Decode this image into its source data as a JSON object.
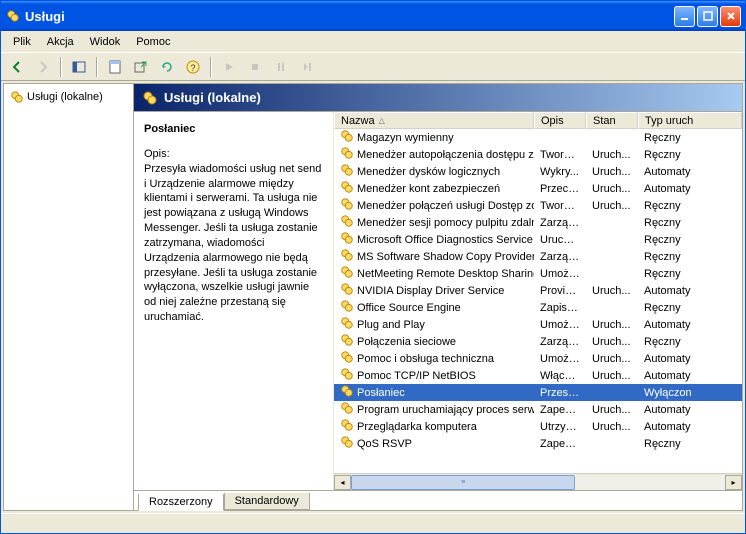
{
  "title": "Usługi",
  "menu": {
    "file": "Plik",
    "action": "Akcja",
    "view": "Widok",
    "help": "Pomoc"
  },
  "tree": {
    "root": "Usługi (lokalne)"
  },
  "header": "Usługi (lokalne)",
  "detail": {
    "name": "Posłaniec",
    "description_label": "Opis:",
    "description": "Przesyła wiadomości usług net send i Urządzenie alarmowe między klientami i serwerami. Ta usługa nie jest powiązana z usługą Windows Messenger. Jeśli ta usługa zostanie zatrzymana, wiadomości Urządzenia alarmowego nie będą przesyłane. Jeśli ta usługa zostanie wyłączona, wszelkie usługi jawnie od niej zależne przestaną się uruchamiać."
  },
  "columns": {
    "name": "Nazwa",
    "desc": "Opis",
    "stat": "Stan",
    "type": "Typ uruch"
  },
  "services": [
    {
      "name": "Magazyn wymienny",
      "desc": "",
      "stat": "",
      "type": "Ręczny",
      "selected": false
    },
    {
      "name": "Menedżer autopołączenia dostępu zd...",
      "desc": "Tworzy...",
      "stat": "Uruch...",
      "type": "Ręczny",
      "selected": false
    },
    {
      "name": "Menedżer dysków logicznych",
      "desc": "Wykry...",
      "stat": "Uruch...",
      "type": "Automaty",
      "selected": false
    },
    {
      "name": "Menedżer kont zabezpieczeń",
      "desc": "Przech...",
      "stat": "Uruch...",
      "type": "Automaty",
      "selected": false
    },
    {
      "name": "Menedżer połączeń usługi Dostęp zda...",
      "desc": "Tworzy...",
      "stat": "Uruch...",
      "type": "Ręczny",
      "selected": false
    },
    {
      "name": "Menedżer sesji pomocy pulpitu zdalnego",
      "desc": "Zarząd...",
      "stat": "",
      "type": "Ręczny",
      "selected": false
    },
    {
      "name": "Microsoft Office Diagnostics Service",
      "desc": "Urucho...",
      "stat": "",
      "type": "Ręczny",
      "selected": false
    },
    {
      "name": "MS Software Shadow Copy Provider",
      "desc": "Zarząd...",
      "stat": "",
      "type": "Ręczny",
      "selected": false
    },
    {
      "name": "NetMeeting Remote Desktop Sharing",
      "desc": "Umożli...",
      "stat": "",
      "type": "Ręczny",
      "selected": false
    },
    {
      "name": "NVIDIA Display Driver Service",
      "desc": "Provide...",
      "stat": "Uruch...",
      "type": "Automaty",
      "selected": false
    },
    {
      "name": "Office Source Engine",
      "desc": "Zapisuj...",
      "stat": "",
      "type": "Ręczny",
      "selected": false
    },
    {
      "name": "Plug and Play",
      "desc": "Umożli...",
      "stat": "Uruch...",
      "type": "Automaty",
      "selected": false
    },
    {
      "name": "Połączenia sieciowe",
      "desc": "Zarząd...",
      "stat": "Uruch...",
      "type": "Ręczny",
      "selected": false
    },
    {
      "name": "Pomoc i obsługa techniczna",
      "desc": "Umożli...",
      "stat": "Uruch...",
      "type": "Automaty",
      "selected": false
    },
    {
      "name": "Pomoc TCP/IP NetBIOS",
      "desc": "Włącza...",
      "stat": "Uruch...",
      "type": "Automaty",
      "selected": false
    },
    {
      "name": "Posłaniec",
      "desc": "Przesył...",
      "stat": "",
      "type": "Wyłączon",
      "selected": true
    },
    {
      "name": "Program uruchamiający proces serwe...",
      "desc": "Zapew...",
      "stat": "Uruch...",
      "type": "Automaty",
      "selected": false
    },
    {
      "name": "Przeglądarka komputera",
      "desc": "Utrzym...",
      "stat": "Uruch...",
      "type": "Automaty",
      "selected": false
    },
    {
      "name": "QoS RSVP",
      "desc": "Zapew...",
      "stat": "",
      "type": "Ręczny",
      "selected": false
    }
  ],
  "tabs": {
    "extended": "Rozszerzony",
    "standard": "Standardowy"
  }
}
